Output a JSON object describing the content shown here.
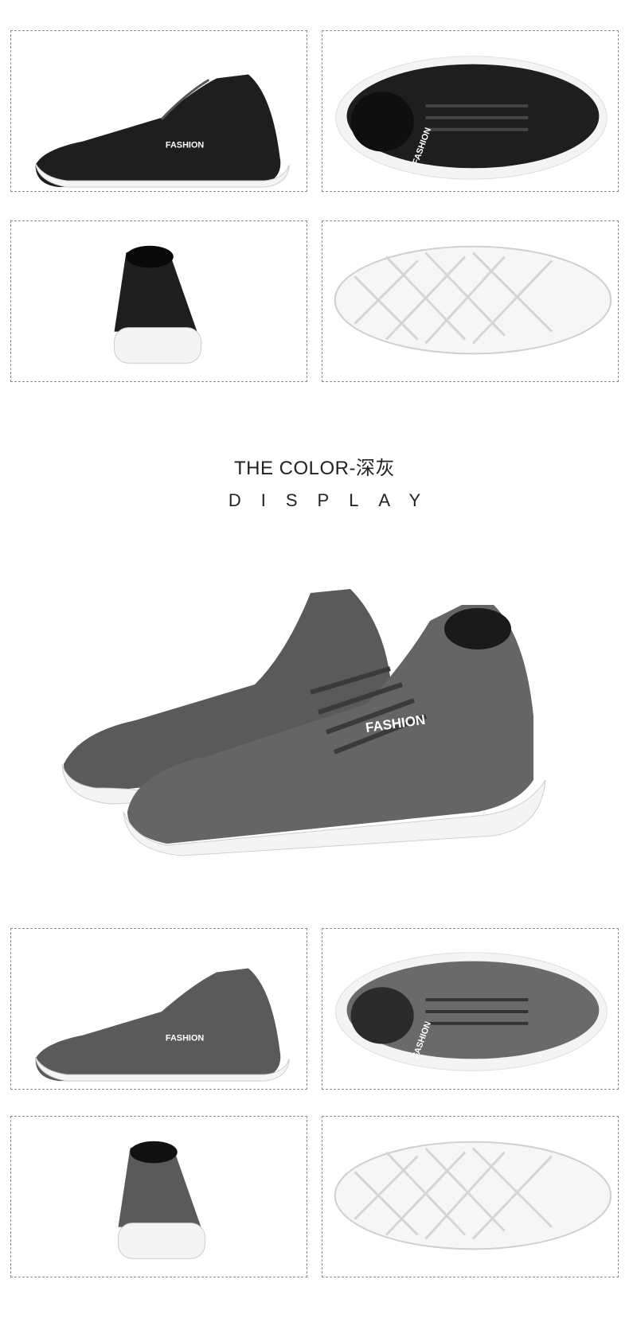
{
  "color_section": {
    "title": "THE COLOR-深灰",
    "subtitle": "DISPLAY"
  },
  "brand_label": "FASHION",
  "colors": {
    "upper_black": "#1e1e1e",
    "upper_grey": "#5a5a5c",
    "sole_white": "#f4f4f4",
    "outline": "#8a8a8a"
  }
}
